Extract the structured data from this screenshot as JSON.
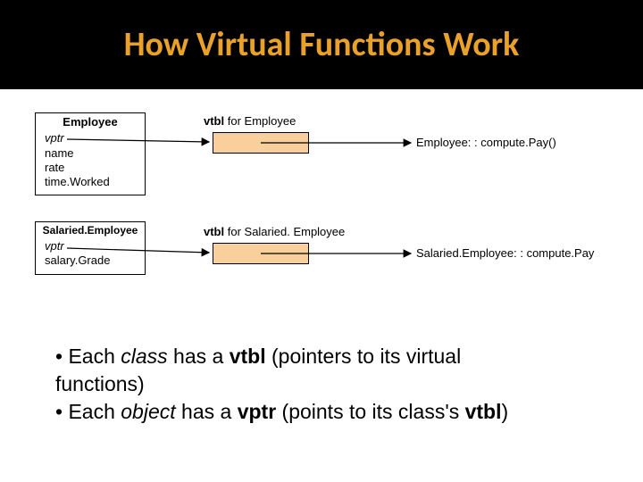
{
  "title": "How Virtual Functions Work",
  "employee": {
    "name": "Employee",
    "fields": [
      "name",
      "rate",
      "time.Worked"
    ],
    "vptr": "vptr",
    "vtbl_label_prefix": "vtbl",
    "vtbl_label_rest": " for Employee",
    "fn": "Employee: : compute.Pay()"
  },
  "salaried": {
    "name": "Salaried.Employee",
    "fields": [
      "salary.Grade"
    ],
    "vptr": "vptr",
    "vtbl_label_prefix": "vtbl",
    "vtbl_label_rest": " for Salaried. Employee",
    "fn": "Salaried.Employee: : compute.Pay"
  },
  "bullets": {
    "line1_pre": "• Each ",
    "line1_it": "class",
    "line1_mid": " has a ",
    "line1_b": "vtbl",
    "line1_post": " (pointers to its virtual",
    "line1_cont": "functions)",
    "line2_pre": "• Each ",
    "line2_it": "object",
    "line2_mid": " has a ",
    "line2_b": "vptr",
    "line2_post": " (points to its class's ",
    "line2_b2": "vtbl",
    "line2_end": ")"
  },
  "colors": {
    "title": "#e9a12a",
    "vtbl_fill": "#f9cf9c"
  }
}
